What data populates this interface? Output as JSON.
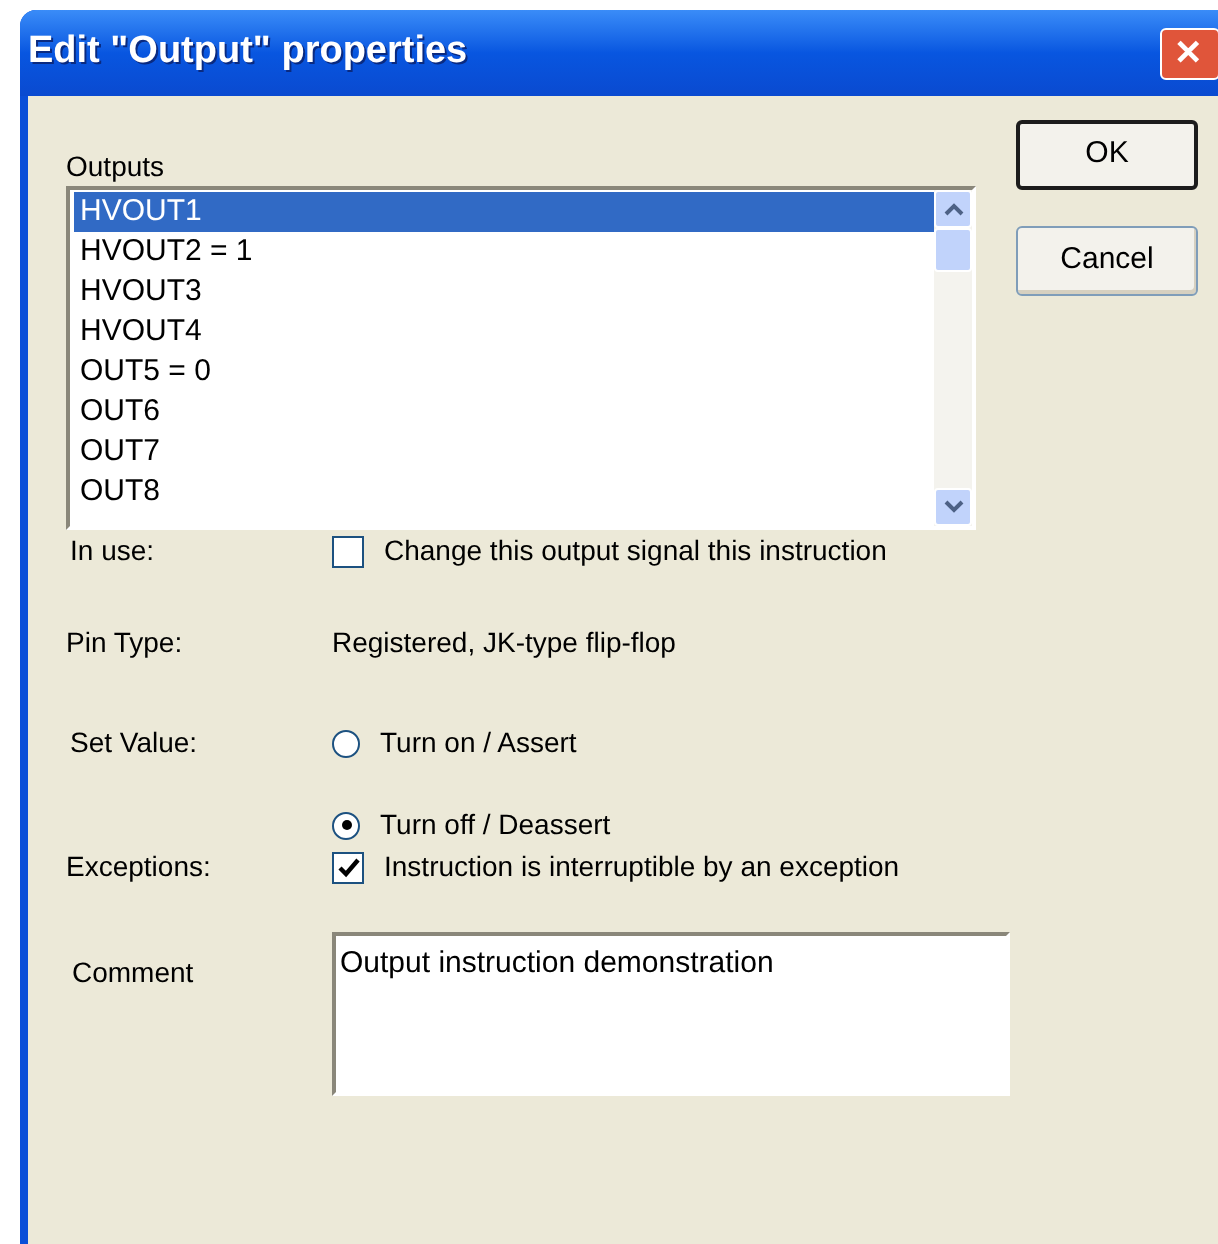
{
  "window": {
    "title": "Edit \"Output\" properties",
    "close": "✕"
  },
  "outputs": {
    "label": "Outputs",
    "items": [
      {
        "text": "HVOUT1",
        "selected": true
      },
      {
        "text": "HVOUT2 = 1",
        "selected": false
      },
      {
        "text": "HVOUT3",
        "selected": false
      },
      {
        "text": "HVOUT4",
        "selected": false
      },
      {
        "text": "OUT5 = 0",
        "selected": false
      },
      {
        "text": "OUT6",
        "selected": false
      },
      {
        "text": "OUT7",
        "selected": false
      },
      {
        "text": "OUT8",
        "selected": false
      }
    ]
  },
  "buttons": [
    "OK",
    "Cancel"
  ],
  "in_use": {
    "label": "In use:",
    "text": "Change this output signal this instruction",
    "checked": false
  },
  "pin_type": {
    "label": "Pin Type:",
    "value": "Registered, JK-type flip-flop"
  },
  "set_value": {
    "label": "Set Value:",
    "options": [
      {
        "text": "Turn on / Assert",
        "selected": false
      },
      {
        "text": "Turn off / Deassert",
        "selected": true
      }
    ]
  },
  "exceptions": {
    "label": "Exceptions:",
    "text": "Instruction is interruptible by an exception",
    "checked": true
  },
  "comment": {
    "label": "Comment",
    "value": "Output instruction demonstration"
  }
}
